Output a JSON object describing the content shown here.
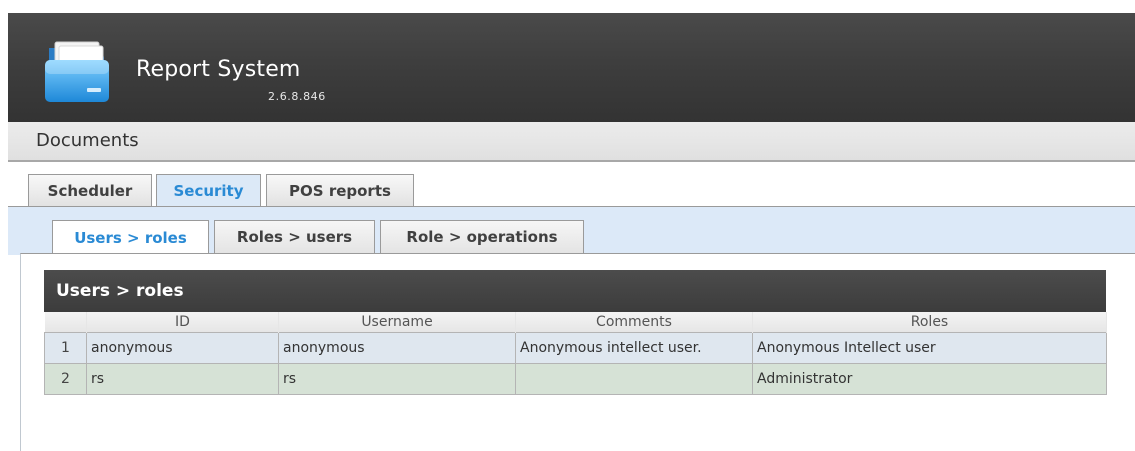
{
  "app": {
    "title": "Report System",
    "version": "2.6.8.846"
  },
  "documents_bar": {
    "title": "Documents"
  },
  "tabs": [
    {
      "label": "Scheduler",
      "active": false
    },
    {
      "label": "Security",
      "active": true
    },
    {
      "label": "POS reports",
      "active": false
    }
  ],
  "subtabs": [
    {
      "label": "Users > roles",
      "active": true
    },
    {
      "label": "Roles > users",
      "active": false
    },
    {
      "label": "Role > operations",
      "active": false
    }
  ],
  "grid": {
    "caption": "Users > roles",
    "columns": [
      "ID",
      "Username",
      "Comments",
      "Roles"
    ],
    "rows": [
      {
        "n": "1",
        "id": "anonymous",
        "username": "anonymous",
        "comments": "Anonymous intellect user.",
        "roles": "Anonymous Intellect user"
      },
      {
        "n": "2",
        "id": "rs",
        "username": "rs",
        "comments": "",
        "roles": "Administrator"
      }
    ]
  },
  "colors": {
    "header_bg": "#3e3e3e",
    "active_tab_text": "#2a8ad4",
    "security_panel_bg": "#dce9f8",
    "row_1_bg": "#dfe7ef",
    "row_2_bg": "#d6e2d6"
  },
  "icons": {
    "logo": "folder-icon"
  }
}
